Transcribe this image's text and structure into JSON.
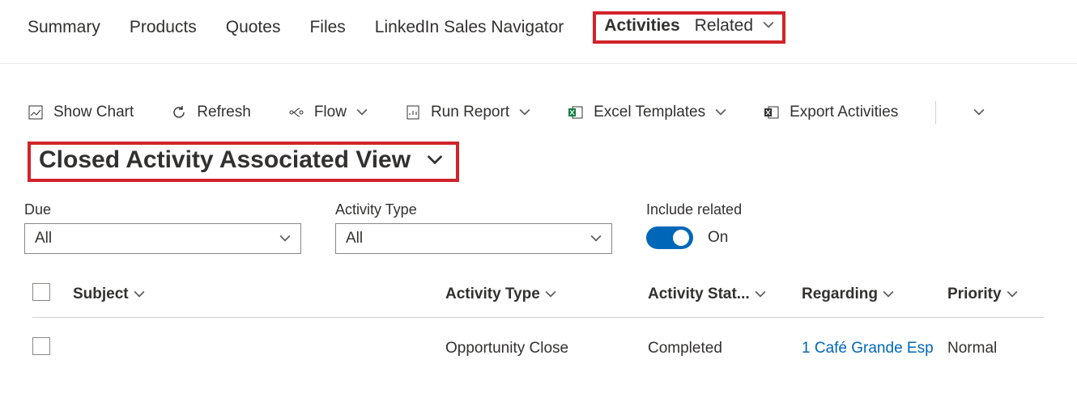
{
  "tabs": {
    "summary": "Summary",
    "products": "Products",
    "quotes": "Quotes",
    "files": "Files",
    "linkedin": "LinkedIn Sales Navigator",
    "activities": "Activities",
    "related": "Related"
  },
  "toolbar": {
    "show_chart": "Show Chart",
    "refresh": "Refresh",
    "flow": "Flow",
    "run_report": "Run Report",
    "excel_templates": "Excel Templates",
    "export_activities": "Export Activities"
  },
  "view": {
    "title": "Closed Activity Associated View"
  },
  "filters": {
    "due_label": "Due",
    "due_value": "All",
    "type_label": "Activity Type",
    "type_value": "All",
    "include_label": "Include related",
    "include_value": "On"
  },
  "columns": {
    "subject": "Subject",
    "activity_type": "Activity Type",
    "activity_status": "Activity Stat...",
    "regarding": "Regarding",
    "priority": "Priority"
  },
  "rows": [
    {
      "subject": "",
      "activity_type": "Opportunity Close",
      "activity_status": "Completed",
      "regarding": "1 Café Grande Esp",
      "priority": "Normal"
    }
  ]
}
